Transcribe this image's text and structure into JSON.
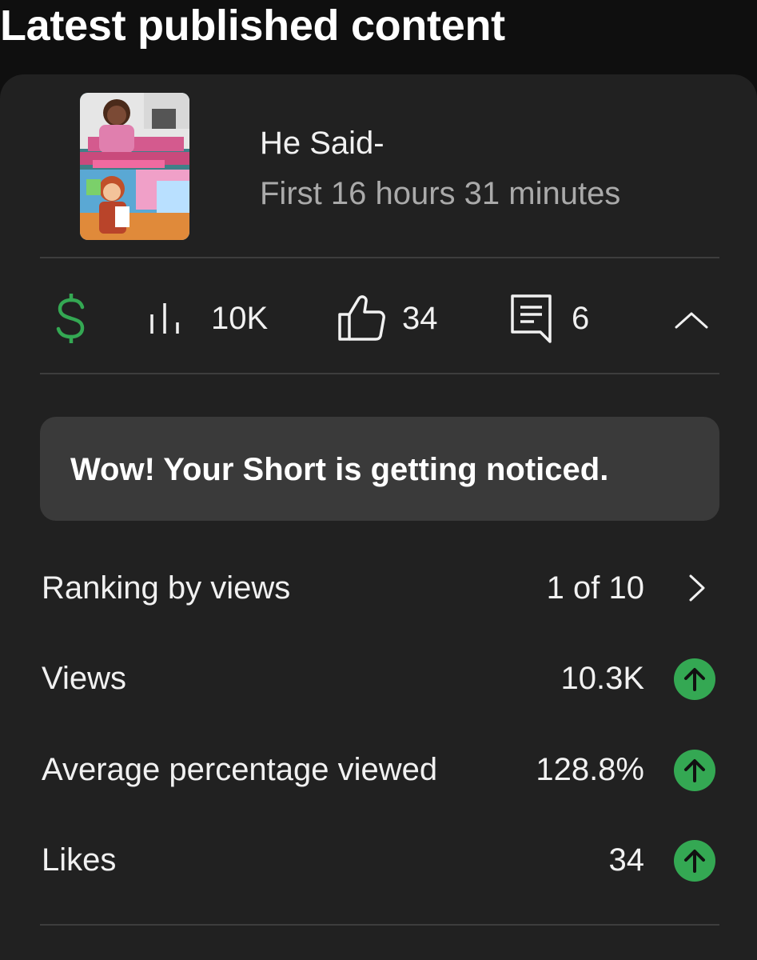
{
  "section": {
    "title": "Latest published content"
  },
  "video": {
    "title": "He Said-",
    "time_label": "First 16 hours 31 minutes",
    "thumbnail_icon": "video-thumbnail"
  },
  "stats": {
    "monetization_icon": "dollar-icon",
    "views_icon": "bar-chart-icon",
    "views": "10K",
    "likes_icon": "thumbs-up-icon",
    "likes": "34",
    "comments_icon": "comment-icon",
    "comments": "6",
    "collapse_icon": "chevron-up-icon"
  },
  "notice": {
    "text": "Wow! Your Short is getting noticed."
  },
  "metrics": [
    {
      "label": "Ranking by views",
      "value": "1 of 10",
      "icon": "chevron-right-icon"
    },
    {
      "label": "Views",
      "value": "10.3K",
      "icon": "arrow-up-icon"
    },
    {
      "label": "Average percentage viewed",
      "value": "128.8%",
      "icon": "arrow-up-icon"
    },
    {
      "label": "Likes",
      "value": "34",
      "icon": "arrow-up-icon"
    }
  ],
  "colors": {
    "background": "#0f0f0f",
    "card": "#212121",
    "notice": "#3a3a3a",
    "positive": "#34a853",
    "monetization": "#34a853",
    "secondary_text": "#aaaaaa"
  }
}
